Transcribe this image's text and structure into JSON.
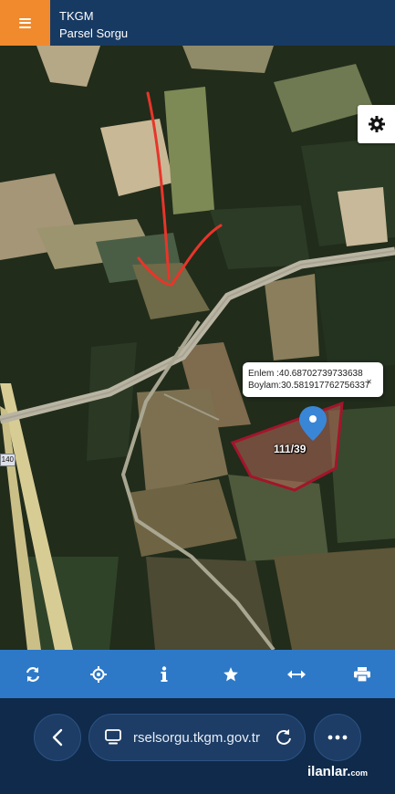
{
  "header": {
    "title": "TKGM",
    "subtitle": "Parsel Sorgu",
    "menu_icon": "hamburger-menu-icon",
    "accent_color": "#f08a2c",
    "bar_color": "#173a63"
  },
  "map": {
    "settings_icon": "gear-icon",
    "popup": {
      "lat_line": "Enlem  :40.68702739733638",
      "lon_line": "Boylam:30.581917762756337",
      "close_glyph": "✕"
    },
    "parcel_label": "111/39",
    "road_sign": "140",
    "parcel_outline_color": "#a3152a",
    "annotation_arrow_color": "#e8352a"
  },
  "toolbar": {
    "color": "#2d79c7",
    "items": [
      {
        "name": "refresh-icon"
      },
      {
        "name": "locate-icon"
      },
      {
        "name": "info-icon"
      },
      {
        "name": "star-icon"
      },
      {
        "name": "measure-icon"
      },
      {
        "name": "print-icon"
      }
    ]
  },
  "browser": {
    "url": "rselsorgu.tkgm.gov.tr",
    "watermark_main": "ilanlar.",
    "watermark_suffix": "com"
  }
}
